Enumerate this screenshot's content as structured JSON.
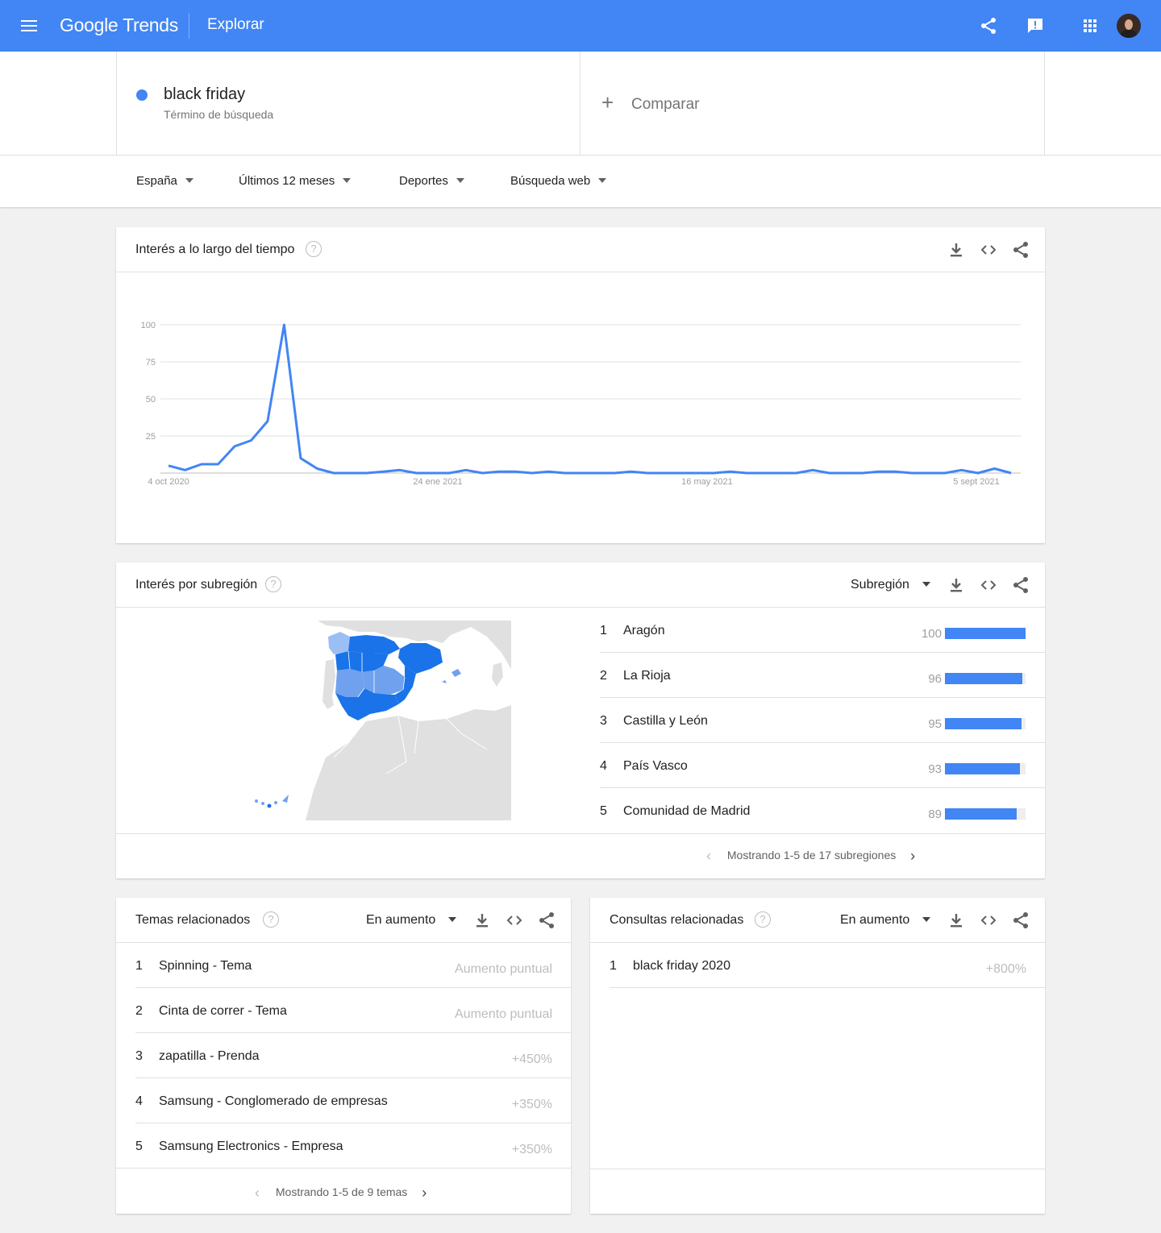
{
  "header": {
    "logo_google": "Google",
    "logo_trends": "Trends",
    "title": "Explorar"
  },
  "search": {
    "term": "black friday",
    "term_type": "Término de búsqueda",
    "term_color": "#4285f4",
    "compare_label": "Comparar"
  },
  "filters": {
    "region": "España",
    "period": "Últimos 12 meses",
    "category": "Deportes",
    "search_type": "Búsqueda web"
  },
  "interest_over_time": {
    "title": "Interés a lo largo del tiempo"
  },
  "chart_data": {
    "type": "line",
    "x_tick_labels": [
      "4 oct 2020",
      "24 ene 2021",
      "16 may 2021",
      "5 sept 2021"
    ],
    "y_ticks": [
      25,
      50,
      75,
      100
    ],
    "ylim": [
      0,
      100
    ],
    "series": [
      {
        "name": "black friday",
        "color": "#4285f4",
        "values": [
          5,
          2,
          6,
          6,
          18,
          22,
          35,
          100,
          10,
          3,
          0,
          0,
          0,
          1,
          2,
          0,
          0,
          0,
          2,
          0,
          1,
          1,
          0,
          1,
          0,
          0,
          0,
          0,
          1,
          0,
          0,
          0,
          0,
          0,
          1,
          0,
          0,
          0,
          0,
          2,
          0,
          0,
          0,
          1,
          1,
          0,
          0,
          0,
          2,
          0,
          3,
          0
        ]
      }
    ]
  },
  "subregion": {
    "title": "Interés por subregión",
    "select_label": "Subregión",
    "rows": [
      {
        "rank": "1",
        "name": "Aragón",
        "value": "100",
        "fill": 1.0
      },
      {
        "rank": "2",
        "name": "La Rioja",
        "value": "96",
        "fill": 0.96
      },
      {
        "rank": "3",
        "name": "Castilla y León",
        "value": "95",
        "fill": 0.95
      },
      {
        "rank": "4",
        "name": "País Vasco",
        "value": "93",
        "fill": 0.93
      },
      {
        "rank": "5",
        "name": "Comunidad de Madrid",
        "value": "89",
        "fill": 0.89
      }
    ],
    "pager": "Mostrando 1-5 de 17 subregiones",
    "map_colors": {
      "high": "#1a73e8",
      "mid": "#6fa1ef",
      "low": "#9bbef5",
      "land": "#e0e0e0",
      "sea": "#ffffff"
    }
  },
  "related_topics": {
    "title": "Temas relacionados",
    "select_label": "En aumento",
    "rows": [
      {
        "rank": "1",
        "name": "Spinning - Tema",
        "value": "Aumento puntual"
      },
      {
        "rank": "2",
        "name": "Cinta de correr - Tema",
        "value": "Aumento puntual"
      },
      {
        "rank": "3",
        "name": "zapatilla - Prenda",
        "value": "+450%"
      },
      {
        "rank": "4",
        "name": "Samsung - Conglomerado de empresas",
        "value": "+350%"
      },
      {
        "rank": "5",
        "name": "Samsung Electronics - Empresa",
        "value": "+350%"
      }
    ],
    "pager": "Mostrando 1-5 de 9 temas"
  },
  "related_queries": {
    "title": "Consultas relacionadas",
    "select_label": "En aumento",
    "rows": [
      {
        "rank": "1",
        "name": "black friday 2020",
        "value": "+800%"
      }
    ]
  },
  "icons": [
    "menu-icon",
    "share-icon",
    "feedback-icon",
    "apps-icon",
    "avatar",
    "help-icon",
    "download-icon",
    "embed-icon",
    "chevron-left-icon",
    "chevron-right-icon"
  ]
}
